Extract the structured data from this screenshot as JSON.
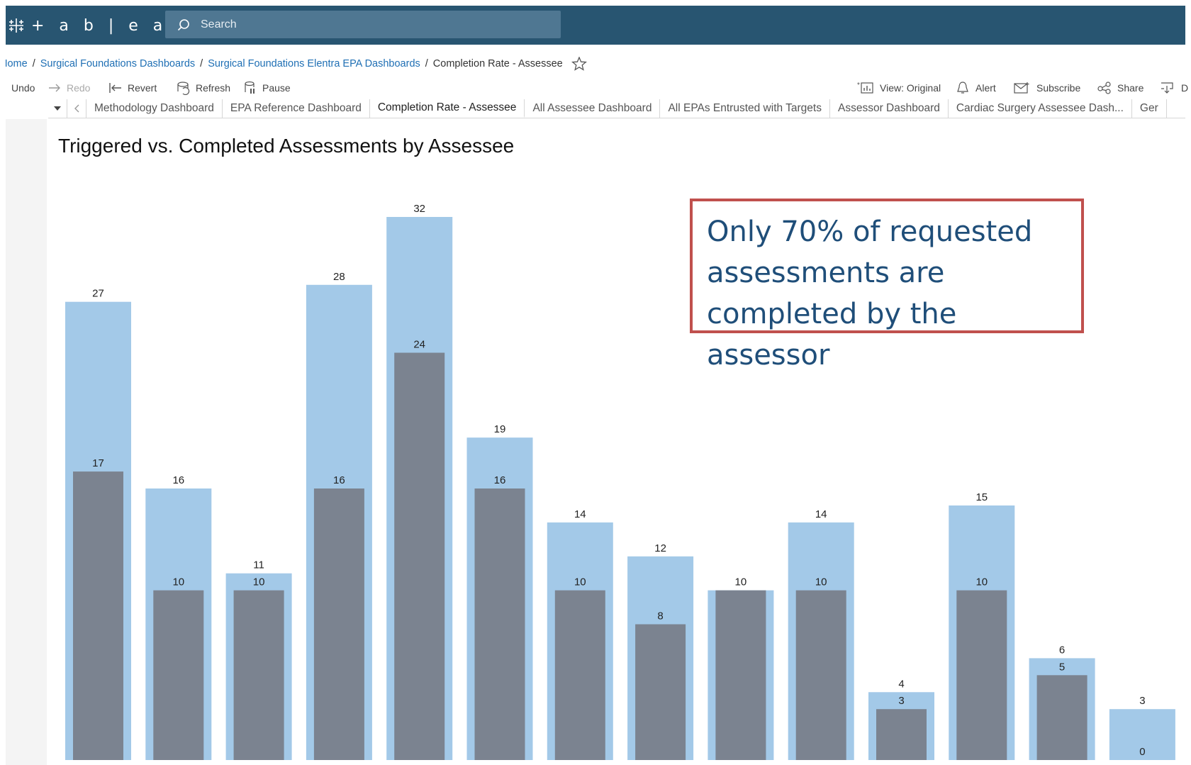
{
  "app": {
    "logo_text": "+ a b | e a u"
  },
  "search": {
    "placeholder": "Search"
  },
  "breadcrumb": {
    "items": [
      "Home",
      "Surgical Foundations Dashboards",
      "Surgical Foundations Elentra EPA Dashboards"
    ],
    "current": "Completion Rate - Assessee"
  },
  "toolbar": {
    "undo": "Undo",
    "redo": "Redo",
    "revert": "Revert",
    "refresh": "Refresh",
    "pause": "Pause",
    "view": "View: Original",
    "alert": "Alert",
    "subscribe": "Subscribe",
    "share": "Share",
    "download": "D"
  },
  "tabs": [
    {
      "label": "Methodology Dashboard",
      "active": false
    },
    {
      "label": "EPA Reference Dashboard",
      "active": false
    },
    {
      "label": "Completion Rate - Assessee",
      "active": true
    },
    {
      "label": "All Assessee Dashboard",
      "active": false
    },
    {
      "label": "All EPAs Entrusted with Targets",
      "active": false
    },
    {
      "label": "Assessor Dashboard",
      "active": false
    },
    {
      "label": "Cardiac Surgery Assessee Dash...",
      "active": false
    },
    {
      "label": "Ger",
      "active": false
    }
  ],
  "callout": {
    "lines": [
      "Only 70% of requested",
      "assessments are",
      "completed by the assessor"
    ]
  },
  "colors": {
    "triggered": "#a3c9e8",
    "completed": "#7b8390",
    "topbar": "#285571",
    "callout_border": "#c0504d",
    "callout_text": "#1f4e79"
  },
  "chart_data": {
    "type": "bar",
    "title": "Triggered vs. Completed Assessments by Assessee",
    "series": [
      {
        "values": [
          27,
          16,
          11,
          28,
          32,
          19,
          14,
          12,
          10,
          14,
          4,
          15,
          6,
          3
        ]
      },
      {
        "values": [
          17,
          10,
          10,
          16,
          24,
          16,
          10,
          8,
          10,
          10,
          3,
          10,
          5,
          0
        ]
      }
    ],
    "ylim": [
      0,
      32
    ],
    "grid": false
  }
}
